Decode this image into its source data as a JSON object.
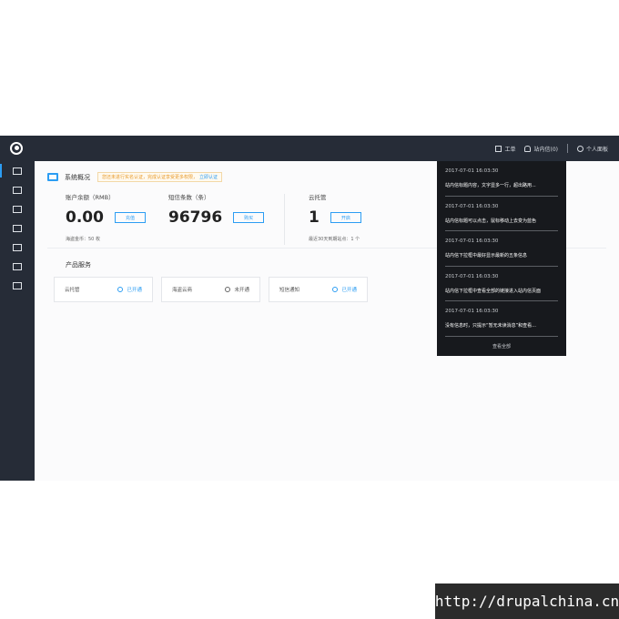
{
  "topbar": {
    "nav": [
      {
        "icon": "ticket-icon",
        "label": "工单"
      },
      {
        "icon": "bell-icon",
        "label": "站内信(0)"
      },
      {
        "icon": "user-icon",
        "label": "个人面板"
      }
    ]
  },
  "sidebar": {
    "items": [
      {
        "icon": "monitor-icon",
        "active": true
      },
      {
        "icon": "grid-icon"
      },
      {
        "icon": "save-icon"
      },
      {
        "icon": "mail-icon"
      },
      {
        "icon": "cloud-icon"
      },
      {
        "icon": "id-card-icon"
      },
      {
        "icon": "box-icon"
      }
    ]
  },
  "overview": {
    "title": "系统概况",
    "notice": "您还未进行实名认证，完成认证享受更多权限，",
    "notice_link": "立即认证"
  },
  "stats": {
    "balance": {
      "label": "账户余额（RMB）",
      "value": "0.00",
      "button": "充值",
      "sub": "海盗金币：50 枚"
    },
    "sms": {
      "label": "短信条数（条）",
      "value": "96796",
      "button": "购买"
    },
    "hosting": {
      "label": "云托管",
      "value": "1",
      "button": "开启",
      "sub": "最近30天到期站点：1 个"
    }
  },
  "products": {
    "title": "产品服务",
    "cards": [
      {
        "name": "云托管",
        "status": "已开通",
        "enabled": true
      },
      {
        "name": "海盗云商",
        "status": "未开通",
        "enabled": false
      },
      {
        "name": "短信通知",
        "status": "已开通",
        "enabled": true
      }
    ]
  },
  "messages": {
    "items": [
      {
        "time": "2017-07-01 16:03:30",
        "text": "站内信标题内容，文字显多一行，超出路用..."
      },
      {
        "time": "2017-07-01 16:03:30",
        "text": "站内信标题可以点击，鼠标移动上去变为蓝色"
      },
      {
        "time": "2017-07-01 16:03:30",
        "text": "站内信下拉框中最好显示最新的五条信息"
      },
      {
        "time": "2017-07-01 16:03:30",
        "text": "站内信下拉框中查看全部的链接进入站内信页面"
      },
      {
        "time": "2017-07-01 16:03:30",
        "text": "没有信息时，只提示“暂无未读消息”和查看..."
      }
    ],
    "view_all": "查看全部"
  },
  "watermark": "http://drupalchina.cn",
  "colors": {
    "sidebar": "#262c37",
    "accent": "#2c9df3",
    "dropdown": "#17191d"
  }
}
